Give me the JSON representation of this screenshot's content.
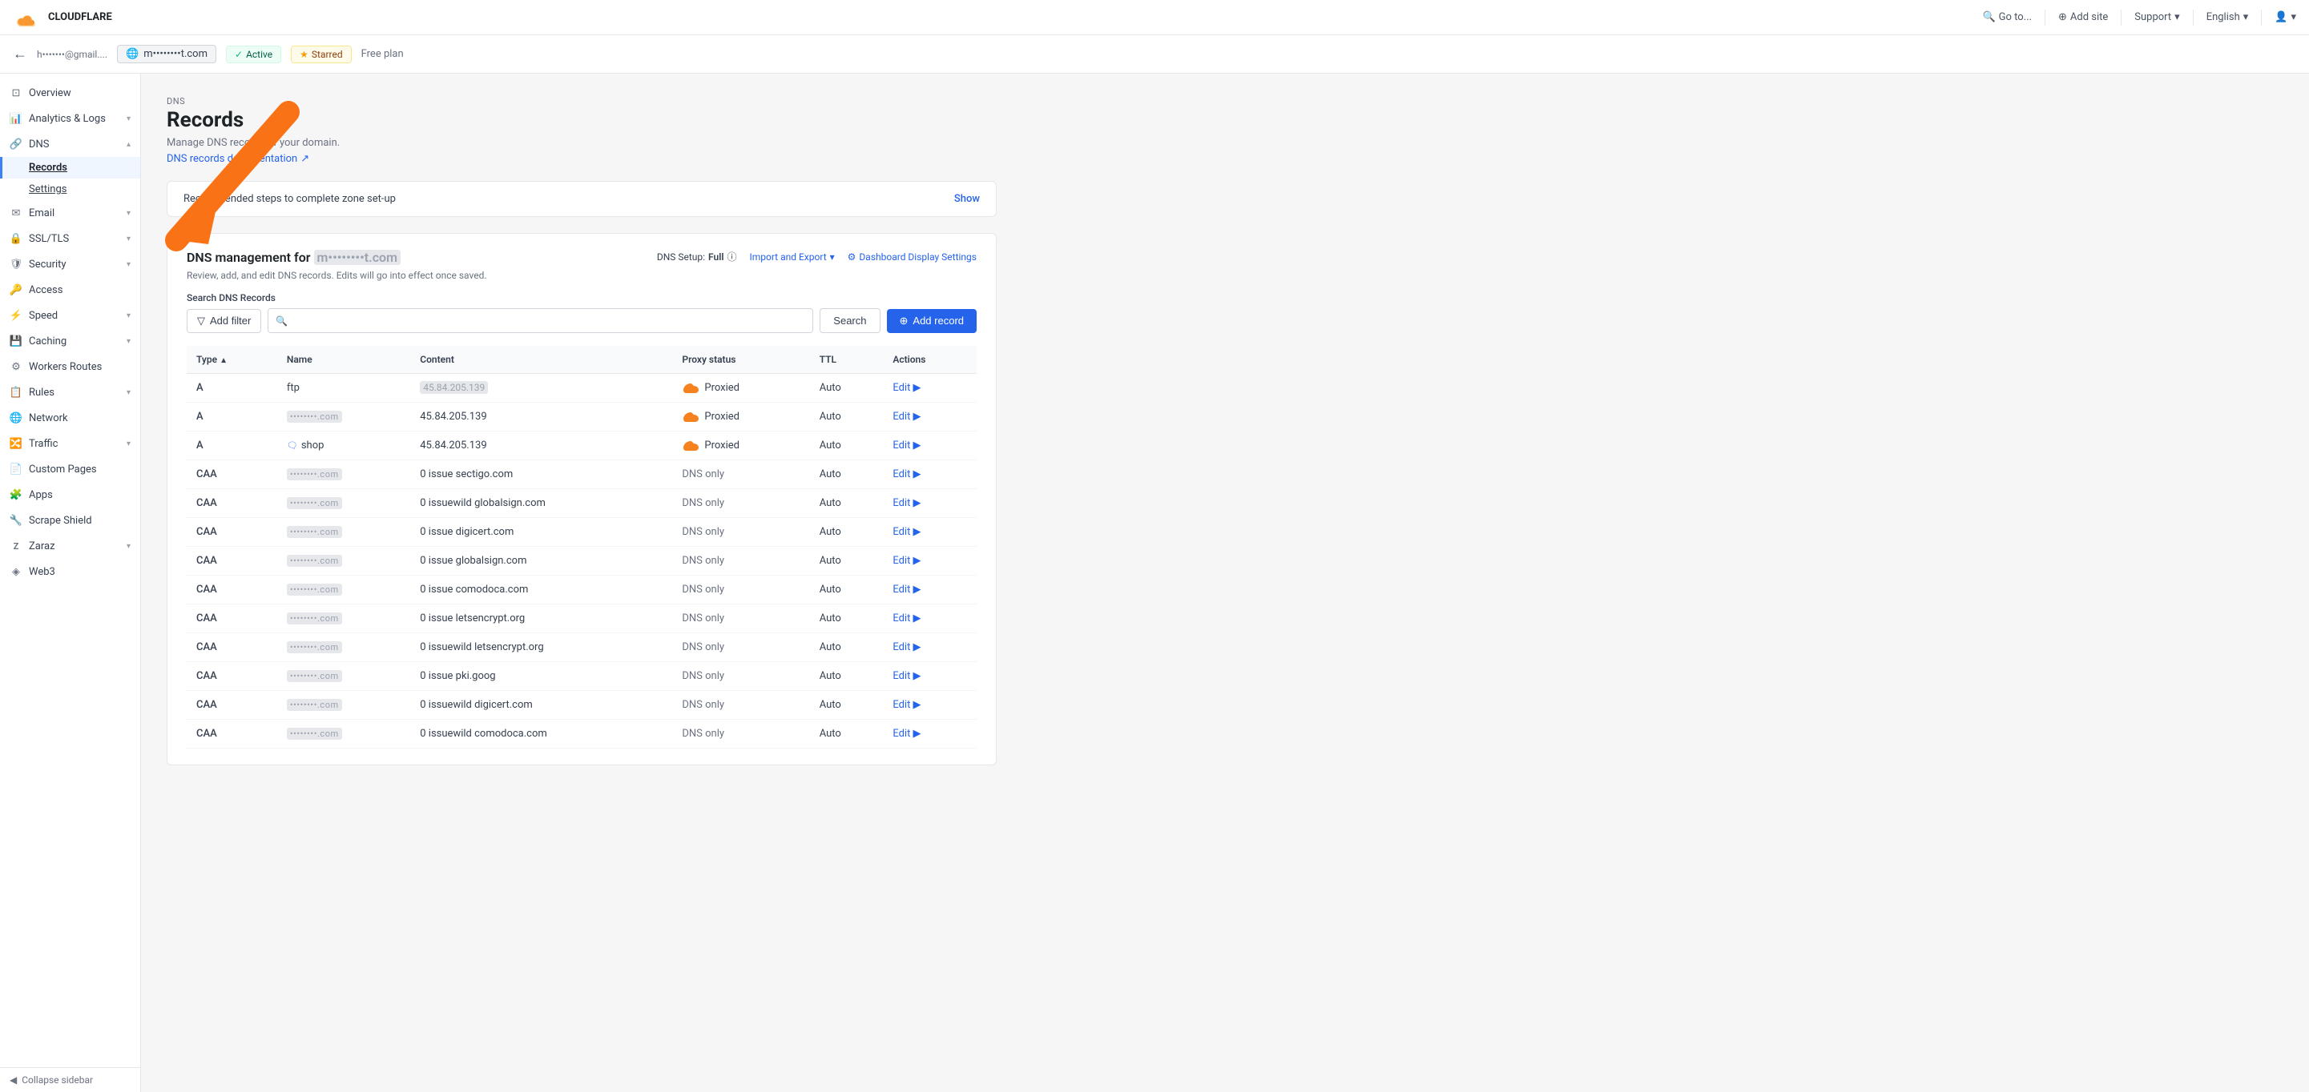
{
  "topNav": {
    "logo_text": "CLOUDFLARE",
    "go_to": "Go to...",
    "add_site": "Add site",
    "support": "Support",
    "language": "English",
    "user_icon": "▾"
  },
  "subNav": {
    "back_icon": "←",
    "domain": "m••••••••t.com",
    "status": "Active",
    "starred": "Starred",
    "plan": "Free plan"
  },
  "sidebar": {
    "items": [
      {
        "id": "overview",
        "label": "Overview",
        "icon": "⊡",
        "has_sub": false
      },
      {
        "id": "analytics",
        "label": "Analytics & Logs",
        "icon": "📈",
        "has_sub": true
      },
      {
        "id": "dns",
        "label": "DNS",
        "icon": "🔗",
        "has_sub": true,
        "expanded": true
      },
      {
        "id": "email",
        "label": "Email",
        "icon": "✉",
        "has_sub": true
      },
      {
        "id": "ssl",
        "label": "SSL/TLS",
        "icon": "🔒",
        "has_sub": true
      },
      {
        "id": "security",
        "label": "Security",
        "icon": "🛡",
        "has_sub": true
      },
      {
        "id": "access",
        "label": "Access",
        "icon": "🔑",
        "has_sub": false
      },
      {
        "id": "speed",
        "label": "Speed",
        "icon": "⚡",
        "has_sub": true
      },
      {
        "id": "caching",
        "label": "Caching",
        "icon": "💾",
        "has_sub": true
      },
      {
        "id": "workers-routes",
        "label": "Workers Routes",
        "icon": "⚙",
        "has_sub": false
      },
      {
        "id": "rules",
        "label": "Rules",
        "icon": "📋",
        "has_sub": true
      },
      {
        "id": "network",
        "label": "Network",
        "icon": "🌐",
        "has_sub": false
      },
      {
        "id": "traffic",
        "label": "Traffic",
        "icon": "🔀",
        "has_sub": true
      },
      {
        "id": "custom-pages",
        "label": "Custom Pages",
        "icon": "📄",
        "has_sub": false
      },
      {
        "id": "apps",
        "label": "Apps",
        "icon": "🧩",
        "has_sub": false
      },
      {
        "id": "scrape-shield",
        "label": "Scrape Shield",
        "icon": "🔧",
        "has_sub": false
      },
      {
        "id": "zaraz",
        "label": "Zaraz",
        "icon": "Z",
        "has_sub": true
      },
      {
        "id": "web3",
        "label": "Web3",
        "icon": "◈",
        "has_sub": false
      }
    ],
    "dns_sub": [
      {
        "id": "records",
        "label": "Records",
        "active": true
      },
      {
        "id": "settings",
        "label": "Settings"
      }
    ],
    "collapse_label": "Collapse sidebar"
  },
  "page": {
    "section": "DNS",
    "title": "Records",
    "description": "Manage DNS records of your domain.",
    "link_text": "DNS records documentation",
    "link_icon": "↗"
  },
  "rec_banner": {
    "text": "Recommended steps to complete zone set-up",
    "action": "Show"
  },
  "dns_management": {
    "title_prefix": "DNS management for ",
    "domain": "m••••••••t.com",
    "description": "Review, add, and edit DNS records. Edits will go into effect once saved.",
    "setup_label": "DNS Setup:",
    "setup_value": "Full",
    "info_icon": "ⓘ",
    "import_label": "Import and Export",
    "import_icon": "▾",
    "display_label": "Dashboard Display Settings",
    "display_icon": "⚙",
    "search_section_label": "Search DNS Records",
    "filter_btn": "Add filter",
    "search_placeholder": "",
    "search_btn": "Search",
    "add_record_btn": "+ Add record"
  },
  "table": {
    "columns": [
      "Type",
      "Name",
      "Content",
      "Proxy status",
      "TTL",
      "Actions"
    ],
    "rows": [
      {
        "type": "A",
        "name": "ftp",
        "content": "45.84.205.139",
        "proxy": "Proxied",
        "ttl": "Auto",
        "action": "Edit ▶"
      },
      {
        "type": "A",
        "name": "BLURRED",
        "content": "45.84.205.139",
        "proxy": "Proxied",
        "ttl": "Auto",
        "action": "Edit ▶"
      },
      {
        "type": "A",
        "name": "shop",
        "content": "45.84.205.139",
        "proxy": "Proxied",
        "ttl": "Auto",
        "action": "Edit ▶",
        "has_icon": true
      },
      {
        "type": "CAA",
        "name": "BLURRED",
        "content": "0 issue sectigo.com",
        "proxy": "DNS only",
        "ttl": "Auto",
        "action": "Edit ▶"
      },
      {
        "type": "CAA",
        "name": "BLURRED",
        "content": "0 issuewild globalsign.com",
        "proxy": "DNS only",
        "ttl": "Auto",
        "action": "Edit ▶"
      },
      {
        "type": "CAA",
        "name": "BLURRED",
        "content": "0 issue digicert.com",
        "proxy": "DNS only",
        "ttl": "Auto",
        "action": "Edit ▶"
      },
      {
        "type": "CAA",
        "name": "BLURRED",
        "content": "0 issue globalsign.com",
        "proxy": "DNS only",
        "ttl": "Auto",
        "action": "Edit ▶"
      },
      {
        "type": "CAA",
        "name": "BLURRED",
        "content": "0 issue comodoca.com",
        "proxy": "DNS only",
        "ttl": "Auto",
        "action": "Edit ▶"
      },
      {
        "type": "CAA",
        "name": "BLURRED",
        "content": "0 issue letsencrypt.org",
        "proxy": "DNS only",
        "ttl": "Auto",
        "action": "Edit ▶"
      },
      {
        "type": "CAA",
        "name": "BLURRED",
        "content": "0 issuewild letsencrypt.org",
        "proxy": "DNS only",
        "ttl": "Auto",
        "action": "Edit ▶"
      },
      {
        "type": "CAA",
        "name": "BLURRED",
        "content": "0 issue pki.goog",
        "proxy": "DNS only",
        "ttl": "Auto",
        "action": "Edit ▶"
      },
      {
        "type": "CAA",
        "name": "BLURRED",
        "content": "0 issuewild digicert.com",
        "proxy": "DNS only",
        "ttl": "Auto",
        "action": "Edit ▶"
      },
      {
        "type": "CAA",
        "name": "BLURRED",
        "content": "0 issuewild comodoca.com",
        "proxy": "DNS only",
        "ttl": "Auto",
        "action": "Edit ▶"
      }
    ]
  }
}
